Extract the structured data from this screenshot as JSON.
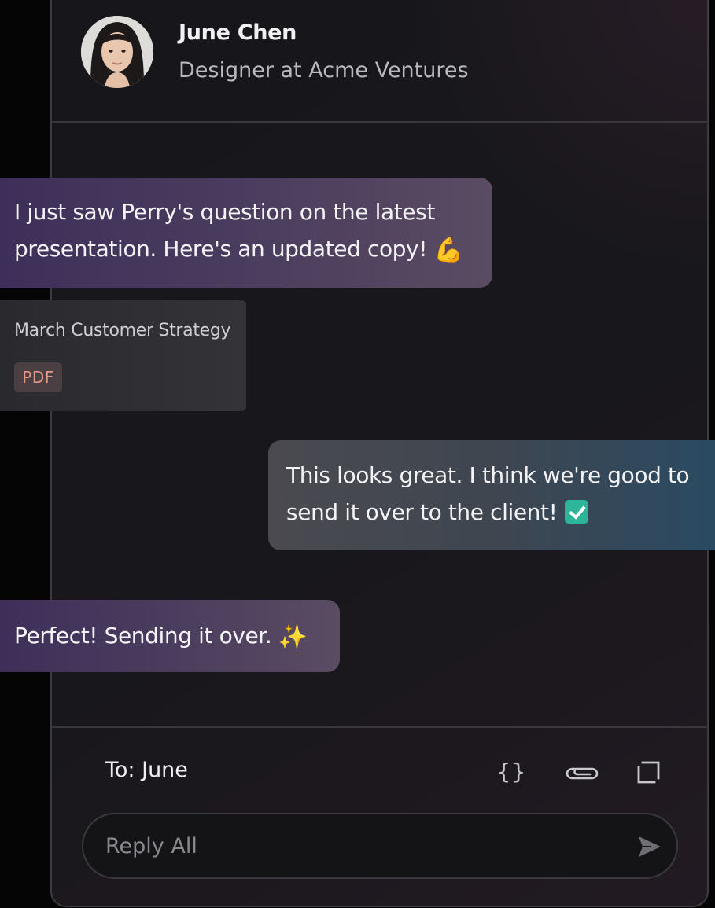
{
  "contact": {
    "name": "June Chen",
    "role": "Designer at Acme Ventures",
    "avatar": "avatar-photo"
  },
  "messages": [
    {
      "direction": "incoming",
      "lines": [
        "I just saw Perry's question on the latest",
        "presentation. Here's an updated copy!"
      ],
      "emoji": "💪"
    },
    {
      "direction": "outgoing",
      "lines": [
        "This looks great. I think we're good to",
        "send it over to the client!"
      ],
      "emoji": "check-mark-button-icon"
    },
    {
      "direction": "incoming",
      "lines": [
        "Perfect! Sending it over."
      ],
      "emoji": "✨"
    }
  ],
  "attachment": {
    "title": "March Customer Strategy",
    "type": "PDF"
  },
  "composer": {
    "recipient": "To: June",
    "placeholder": "Reply All",
    "tools": [
      "code-braces-icon",
      "paperclip-icon",
      "expand-icon"
    ],
    "send": "send-icon"
  },
  "colors": {
    "background": "#050505",
    "panel": "#17171b",
    "incoming_bubble": "#4c3e5e",
    "outgoing_bubble": "#2a4a62",
    "pdf_badge_text": "#e39888"
  }
}
